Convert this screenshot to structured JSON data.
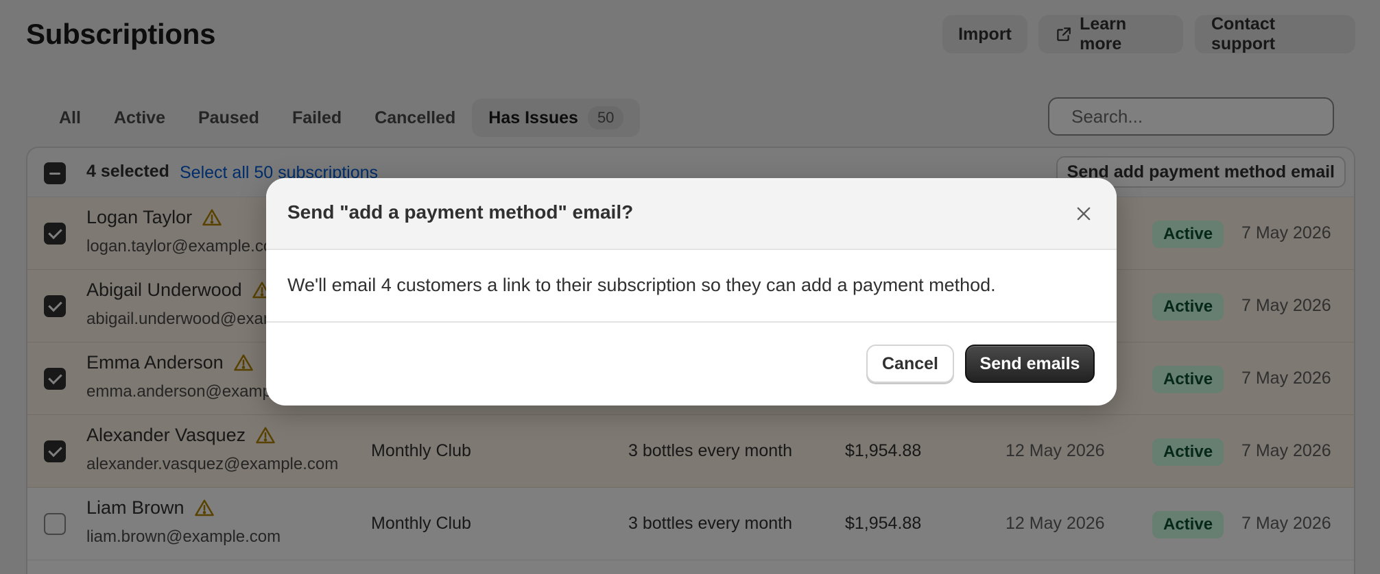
{
  "header": {
    "title": "Subscriptions",
    "import_label": "Import",
    "learn_more_label": "Learn more",
    "contact_support_label": "Contact support"
  },
  "tabs": [
    {
      "label": "All"
    },
    {
      "label": "Active"
    },
    {
      "label": "Paused"
    },
    {
      "label": "Failed"
    },
    {
      "label": "Cancelled"
    },
    {
      "label": "Has Issues",
      "count": "50",
      "selected": true
    }
  ],
  "search": {
    "placeholder": "Search...",
    "value": ""
  },
  "bulk": {
    "selected_text": "4 selected",
    "select_all_link": "Select all 50 subscriptions",
    "action_label": "Send add payment method email"
  },
  "rows": [
    {
      "name": "Logan Taylor",
      "email": "logan.taylor@example.com",
      "plan": "",
      "quantity": "",
      "amount": "",
      "next_date": "",
      "status": "Active",
      "date": "7 May 2026",
      "checked": true
    },
    {
      "name": "Abigail Underwood",
      "email": "abigail.underwood@example.com",
      "plan": "",
      "quantity": "",
      "amount": "",
      "next_date": "",
      "status": "Active",
      "date": "7 May 2026",
      "checked": true
    },
    {
      "name": "Emma Anderson",
      "email": "emma.anderson@example.com",
      "plan": "",
      "quantity": "",
      "amount": "",
      "next_date": "",
      "status": "Active",
      "date": "7 May 2026",
      "checked": true
    },
    {
      "name": "Alexander Vasquez",
      "email": "alexander.vasquez@example.com",
      "plan": "Monthly Club",
      "quantity": "3 bottles every month",
      "amount": "$1,954.88",
      "next_date": "12 May 2026",
      "status": "Active",
      "date": "7 May 2026",
      "checked": true
    },
    {
      "name": "Liam Brown",
      "email": "liam.brown@example.com",
      "plan": "Monthly Club",
      "quantity": "3 bottles every month",
      "amount": "$1,954.88",
      "next_date": "12 May 2026",
      "status": "Active",
      "date": "7 May 2026",
      "checked": false
    }
  ],
  "modal": {
    "title": "Send \"add a payment method\" email?",
    "body": "We'll email 4 customers a link to their subscription so they can add a payment method.",
    "cancel_label": "Cancel",
    "confirm_label": "Send emails"
  },
  "icons": {
    "warning": "warning-icon",
    "external_link": "external-link-icon",
    "close": "close-icon"
  },
  "colors": {
    "status_badge_bg": "#cdfee1",
    "status_badge_text": "#0c5132",
    "link": "#005bd3",
    "warning": "#b28400",
    "primary_button": "#303030"
  }
}
